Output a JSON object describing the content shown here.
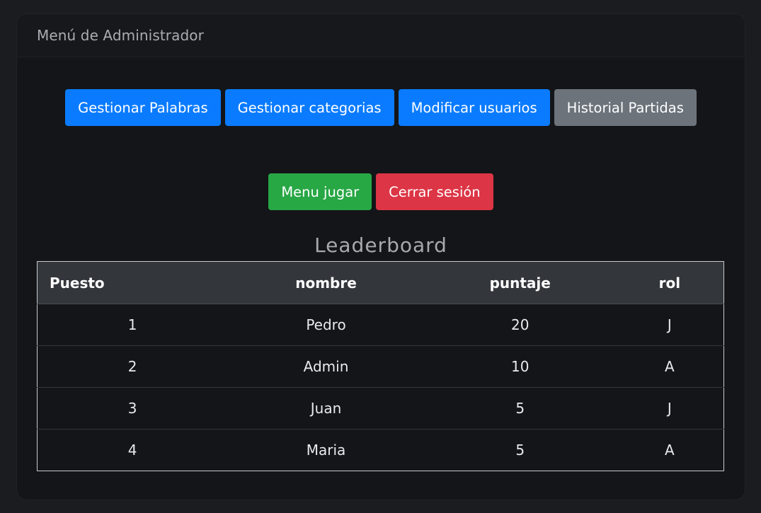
{
  "header": {
    "title": "Menú de Administrador"
  },
  "admin_buttons": [
    {
      "label": "Gestionar Palabras",
      "color": "#0a7bff"
    },
    {
      "label": "Gestionar categorias",
      "color": "#0a7bff"
    },
    {
      "label": "Modificar usuarios",
      "color": "#0a7bff"
    },
    {
      "label": "Historial Partidas",
      "color": "#6c737b"
    }
  ],
  "session_buttons": [
    {
      "label": "Menu jugar",
      "color": "#28a745"
    },
    {
      "label": "Cerrar sesión",
      "color": "#dc3545"
    }
  ],
  "leaderboard": {
    "title": "Leaderboard",
    "columns": [
      "Puesto",
      "nombre",
      "puntaje",
      "rol"
    ],
    "rows": [
      [
        "1",
        "Pedro",
        "20",
        "J"
      ],
      [
        "2",
        "Admin",
        "10",
        "A"
      ],
      [
        "3",
        "Juan",
        "5",
        "J"
      ],
      [
        "4",
        "Maria",
        "5",
        "A"
      ]
    ]
  }
}
